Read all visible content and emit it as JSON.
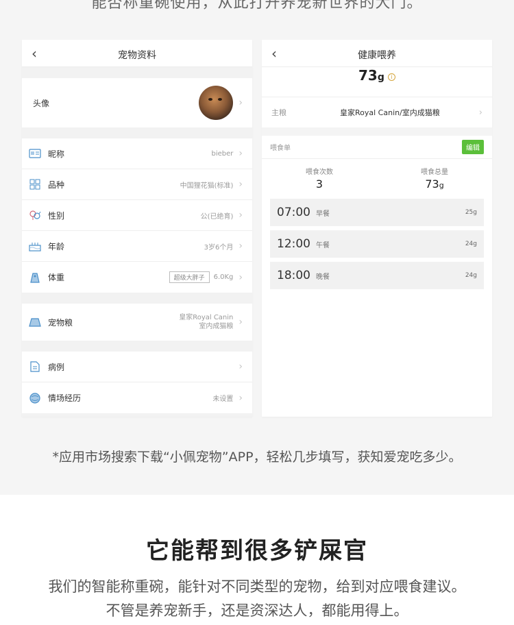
{
  "top_caption": "能否称重碗使用，从此打开养宠新世界的大门。",
  "profile": {
    "title": "宠物资料",
    "avatar_label": "头像",
    "items": [
      {
        "label": "昵称",
        "value": "bieber"
      },
      {
        "label": "品种",
        "value": "中国狸花猫(标准)"
      },
      {
        "label": "性别",
        "value": "公(已绝育)"
      },
      {
        "label": "年龄",
        "value": "3岁6个月"
      },
      {
        "label": "体重",
        "tag": "超级大胖子",
        "value": "6.0Kg"
      }
    ],
    "food": {
      "label": "宠物粮",
      "line1": "皇家Royal Canin",
      "line2": "室内成猫粮"
    },
    "extra": [
      {
        "label": "病例",
        "value": ""
      },
      {
        "label": "情场经历",
        "value": "未设置"
      }
    ]
  },
  "feeding": {
    "title": "健康喂养",
    "total_num": "73",
    "total_unit": "g",
    "info_symbol": "i",
    "main_food_label": "主粮",
    "main_food_value": "皇家Royal Canin/室内成猫粮",
    "menu_label": "喂食单",
    "edit_label": "编辑",
    "count_label": "喂食次数",
    "count_value": "3",
    "amount_label": "喂食总量",
    "amount_value": "73",
    "amount_unit": "g",
    "meals": [
      {
        "time": "07:00",
        "name": "早餐",
        "grams": "25g"
      },
      {
        "time": "12:00",
        "name": "午餐",
        "grams": "24g"
      },
      {
        "time": "18:00",
        "name": "晚餐",
        "grams": "24g"
      }
    ]
  },
  "footnote": "*应用市场搜索下载“小佩宠物”APP，轻松几步填写，获知爱宠吃多少。",
  "bottom": {
    "headline": "它能帮到很多铲屎官",
    "line1": "我们的智能称重碗，能针对不同类型的宠物，给到对应喂食建议。",
    "line2": "不管是养宠新手，还是资深达人，都能用得上。"
  },
  "colors": {
    "accent_green": "#5bbf3a",
    "icon_blue": "#4a8fc9",
    "info_gold": "#d4a43a"
  }
}
